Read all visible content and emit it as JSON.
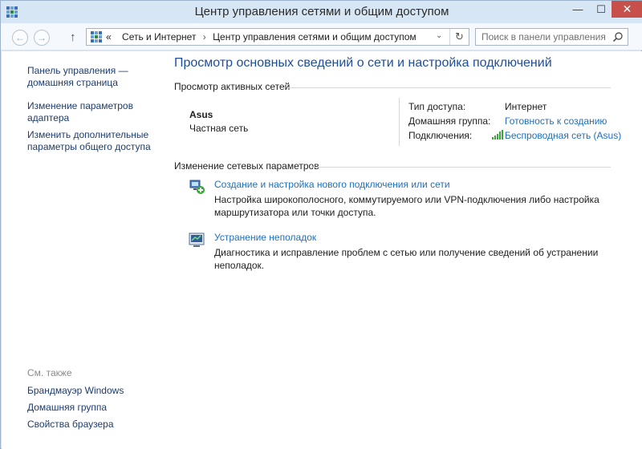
{
  "window": {
    "title": "Центр управления сетями и общим доступом",
    "close_glyph": "✕",
    "maximize_glyph": "☐",
    "minimize_glyph": "—"
  },
  "address": {
    "back_glyph": "←",
    "forward_glyph": "→",
    "up_glyph": "↑",
    "overflow": "«",
    "crumbs": [
      "Сеть и Интернет",
      "Центр управления сетями и общим доступом"
    ],
    "crumb_separator": "›",
    "dropdown_glyph": "⌄",
    "refresh_glyph": "↻",
    "search_placeholder": "Поиск в панели управления"
  },
  "sidebar": {
    "items": [
      {
        "label": "Панель управления — домашняя страница"
      },
      {
        "label": "Изменение параметров адаптера"
      },
      {
        "label": "Изменить дополнительные параметры общего доступа"
      }
    ],
    "see_also": {
      "heading": "См. также",
      "items": [
        {
          "label": "Брандмауэр Windows"
        },
        {
          "label": "Домашняя группа"
        },
        {
          "label": "Свойства браузера"
        }
      ]
    }
  },
  "main": {
    "title": "Просмотр основных сведений о сети и настройка подключений",
    "active_networks": {
      "heading": "Просмотр активных сетей",
      "network_name": "Asus",
      "network_category": "Частная сеть",
      "access_type_label": "Тип доступа:",
      "access_type_value": "Интернет",
      "homegroup_label": "Домашняя группа:",
      "homegroup_value": "Готовность к созданию",
      "connections_label": "Подключения:",
      "connections_value": "Беспроводная сеть (Asus)"
    },
    "change_settings": {
      "heading": "Изменение сетевых параметров",
      "tasks": [
        {
          "icon": "network-setup-icon",
          "link": "Создание и настройка нового подключения или сети",
          "description": "Настройка широкополосного, коммутируемого или VPN-подключения либо настройка маршрутизатора или точки доступа."
        },
        {
          "icon": "troubleshoot-icon",
          "link": "Устранение неполадок",
          "description": "Диагностика и исправление проблем с сетью или получение сведений об устранении неполадок."
        }
      ]
    }
  },
  "colors": {
    "title_blue": "#1f4e98",
    "link_blue": "#1f6fbd",
    "close_red": "#c7504a",
    "chrome": "#d7e6f4"
  }
}
